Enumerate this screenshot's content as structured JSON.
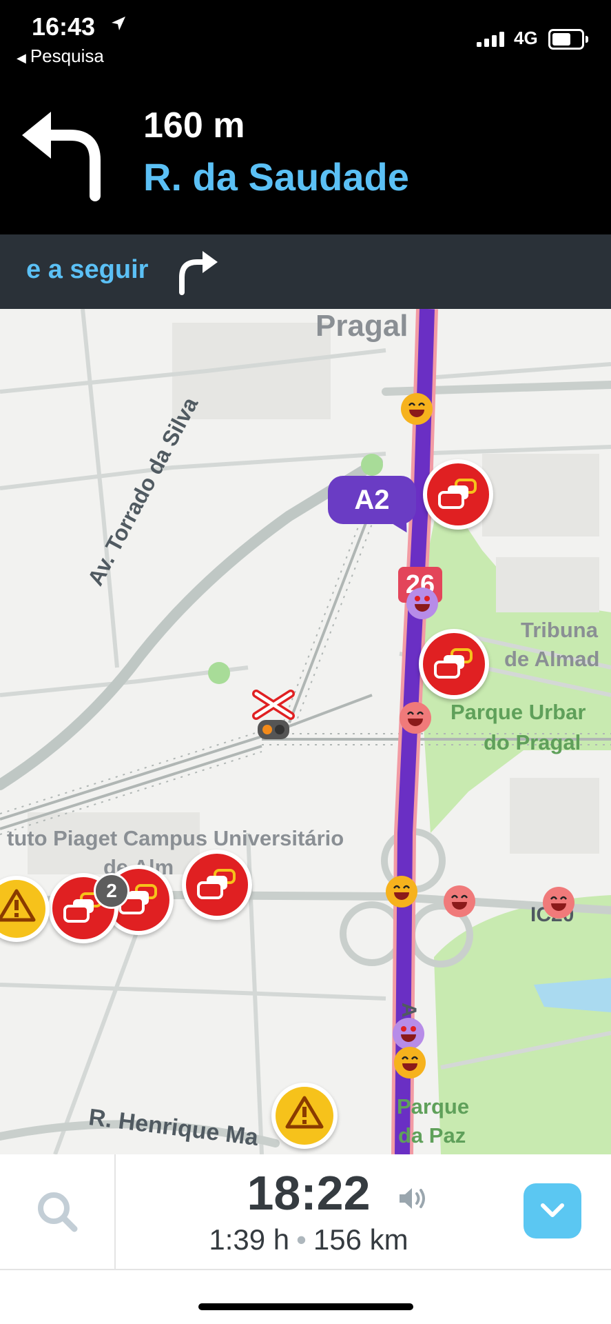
{
  "status_bar": {
    "time": "16:43",
    "back_label": "Pesquisa",
    "network": "4G",
    "icons": [
      "location-arrow-icon",
      "signal-bars-icon",
      "battery-icon"
    ]
  },
  "navigation": {
    "distance": "160 m",
    "street": "R. da Saudade",
    "turn_icon": "turn-left-arrow-icon",
    "next_label": "e a seguir",
    "next_icon": "turn-right-arrow-icon"
  },
  "map": {
    "labels": {
      "pragal": "Pragal",
      "tribunal_line1": "Tribuna",
      "tribunal_line2": "de Almad",
      "parque_urbano_line1": "Parque Urbar",
      "parque_urbano_line2": "do Pragal",
      "piaget_line1": "tuto Piaget Campus Universitário",
      "piaget_line2": "de Alm",
      "av_torrado": "Av. Torrado da Silva",
      "r_henrique": "R. Henrique Ma",
      "parque_paz_line1": "Parque",
      "parque_paz_line2": "da Paz",
      "ic20": "IC20",
      "a2_vertical": "A2"
    },
    "route_badge": "A2",
    "exit_badge": "26",
    "cluster_count": "2",
    "colors": {
      "route": "#6a2fc4",
      "traffic_alert": "#e02022",
      "hazard": "#f6c21b",
      "park": "#c8eab0",
      "water": "#aadaf0"
    }
  },
  "bottom_bar": {
    "eta_time": "18:22",
    "duration": "1:39 h",
    "separator": "•",
    "distance": "156 km",
    "icons": [
      "search-icon",
      "speaker-icon",
      "chevron-down-icon"
    ]
  }
}
